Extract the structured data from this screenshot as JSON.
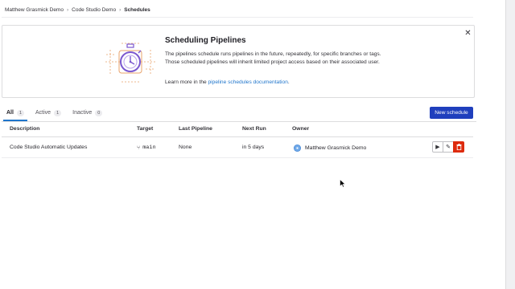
{
  "breadcrumb": {
    "items": [
      "Matthew Grasmick Demo",
      "Code Studio Demo"
    ],
    "current": "Schedules",
    "separator": "›"
  },
  "banner": {
    "title": "Scheduling Pipelines",
    "description": "The pipelines schedule runs pipelines in the future, repeatedly, for specific branches or tags. Those scheduled pipelines will inherit limited project access based on their associated user.",
    "learn_prefix": "Learn more in the ",
    "learn_link": "pipeline schedules documentation",
    "learn_suffix": ".",
    "close_icon": "close-icon",
    "illustration": "stopwatch-illustration"
  },
  "tabs": [
    {
      "label": "All",
      "count": "1"
    },
    {
      "label": "Active",
      "count": "1"
    },
    {
      "label": "Inactive",
      "count": "0"
    }
  ],
  "new_schedule_label": "New schedule",
  "table": {
    "headers": {
      "description": "Description",
      "target": "Target",
      "last_pipeline": "Last Pipeline",
      "next_run": "Next Run",
      "owner": "Owner"
    },
    "rows": [
      {
        "description": "Code Studio Automatic Updates",
        "target": "main",
        "last_pipeline": "None",
        "next_run": "in 5 days",
        "owner": "Matthew Grasmick Demo"
      }
    ]
  },
  "icons": {
    "branch": "branch-icon",
    "play": "play-icon",
    "edit": "pencil-icon",
    "delete": "trash-icon"
  },
  "colors": {
    "primary_button": "#1f3fbd",
    "link": "#1f75cb",
    "danger": "#dd2b0e",
    "illustration_purple": "#7b58cf",
    "illustration_orange": "#e9a36b"
  }
}
